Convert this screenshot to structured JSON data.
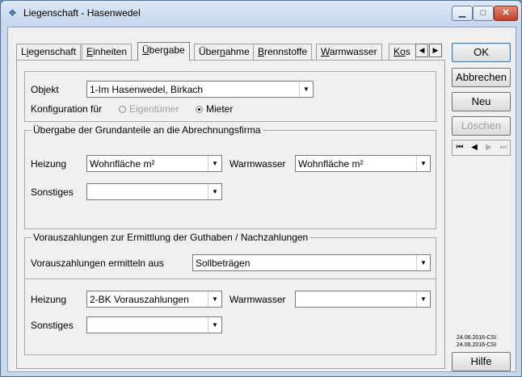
{
  "window": {
    "title": "Liegenschaft - Hasenwedel"
  },
  "tabs": [
    {
      "pre": "L",
      "acc": "i",
      "post": "egenschaft"
    },
    {
      "pre": "",
      "acc": "E",
      "post": "inheiten"
    },
    {
      "pre": "",
      "acc": "Ü",
      "post": "bergabe"
    },
    {
      "pre": "Über",
      "acc": "n",
      "post": "ahme"
    },
    {
      "pre": "",
      "acc": "B",
      "post": "rennstoffe"
    },
    {
      "pre": "",
      "acc": "W",
      "post": "armwasser"
    },
    {
      "pre": "",
      "acc": "Ko",
      "post": "s"
    }
  ],
  "objekt": {
    "label": "Objekt",
    "value": "1-Im Hasenwedel, Birkach",
    "config_label": "Konfiguration für",
    "radio_owner": "Eigentümer",
    "radio_tenant": "Mieter"
  },
  "group1": {
    "title": "Übergabe der Grundanteile an die Abrechnungsfirma",
    "heizung_label": "Heizung",
    "heizung_value": "Wohnfläche m²",
    "warmwasser_label": "Warmwasser",
    "warmwasser_value": "Wohnfläche m²",
    "sonstiges_label": "Sonstiges",
    "sonstiges_value": ""
  },
  "group2": {
    "title": "Vorauszahlungen zur Ermittlung der Guthaben / Nachzahlungen",
    "ermitteln_label": "Vorauszahlungen ermitteln aus",
    "ermitteln_value": "Sollbeträgen",
    "heizung_label": "Heizung",
    "heizung_value": "2-BK Vorauszahlungen",
    "warmwasser_label": "Warmwasser",
    "warmwasser_value": "",
    "sonstiges_label": "Sonstiges",
    "sonstiges_value": ""
  },
  "buttons": {
    "ok": "OK",
    "abbrechen": "Abbrechen",
    "neu": "Neu",
    "loeschen": "Löschen",
    "hilfe": "Hilfe"
  },
  "dates": [
    "24.06.2016-CSI",
    "24.06.2016-CSI"
  ]
}
